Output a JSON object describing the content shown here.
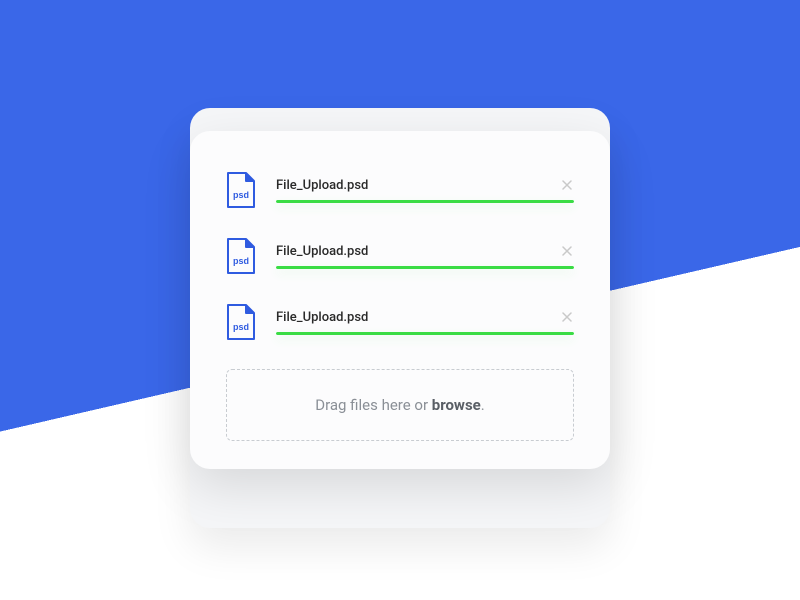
{
  "colors": {
    "accent": "#3a67e8",
    "progress": "#3adc44",
    "file_icon": "#2f5be0"
  },
  "files": [
    {
      "name": "File_Upload.psd",
      "ext_label": "psd",
      "progress_pct": 100
    },
    {
      "name": "File_Upload.psd",
      "ext_label": "psd",
      "progress_pct": 100
    },
    {
      "name": "File_Upload.psd",
      "ext_label": "psd",
      "progress_pct": 100
    }
  ],
  "dropzone": {
    "prefix": "Drag files here or ",
    "action": "browse",
    "suffix": "."
  }
}
